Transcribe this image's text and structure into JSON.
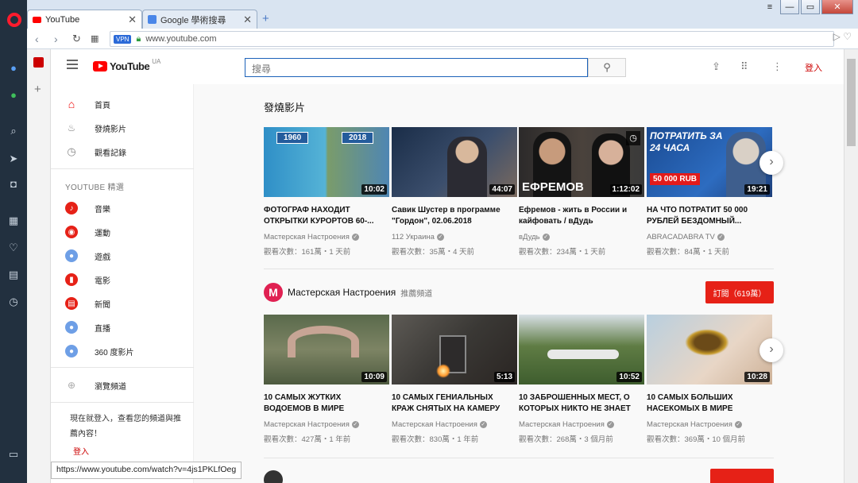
{
  "browser": {
    "tabs": [
      {
        "label": "YouTube",
        "close": "✕"
      },
      {
        "label": "Google 學術搜尋",
        "close": "✕"
      }
    ],
    "new_tab": "+",
    "url": "www.youtube.com",
    "vpn": "VPN",
    "status_url": "https://www.youtube.com/watch?v=4js1PKLfOeg"
  },
  "youtube": {
    "logo": "YouTube",
    "region": "UA",
    "search_placeholder": "搜尋",
    "signin": "登入"
  },
  "guide": {
    "primary": [
      {
        "label": "首頁",
        "icon": "home-icon"
      },
      {
        "label": "發燒影片",
        "icon": "fire-icon"
      },
      {
        "label": "觀看記錄",
        "icon": "history-icon"
      }
    ],
    "section_title": "YOUTUBE 精選",
    "best": [
      {
        "label": "音樂",
        "icon": "music-icon"
      },
      {
        "label": "運動",
        "icon": "sports-icon"
      },
      {
        "label": "遊戲",
        "icon": "gaming-icon"
      },
      {
        "label": "電影",
        "icon": "movies-icon"
      },
      {
        "label": "新聞",
        "icon": "news-icon"
      },
      {
        "label": "直播",
        "icon": "live-icon"
      },
      {
        "label": "360 度影片",
        "icon": "360-icon"
      }
    ],
    "browse": "瀏覽頻道",
    "signin_prompt": "現在就登入，查看您的頻道與推薦內容！",
    "signin_link": "登入"
  },
  "trending": {
    "title": "發燒影片",
    "videos": [
      {
        "title": "ФОТОГРАФ НАХОДИТ ОТКРЫТКИ КУРОРТОВ 60-...",
        "channel": "Мастерская Настроения",
        "views": "觀看次數：161萬・1 天前",
        "duration": "10:02",
        "labels": [
          "1960",
          "2018"
        ]
      },
      {
        "title": "Савик Шустер в программе \"Гордон\", 02.06.2018",
        "channel": "112 Украина",
        "views": "觀看次數：35萬・4 天前",
        "duration": "44:07"
      },
      {
        "title": "Ефремов - жить в России и кайфовать / вДудь",
        "channel": "вДудь",
        "views": "觀看次數：234萬・1 天前",
        "duration": "1:12:02",
        "overlay": "ЕФРЕМОВ"
      },
      {
        "title": "НА ЧТО ПОТРАТИТ 50 000 РУБЛЕЙ БЕЗДОМНЫЙ...",
        "channel": "ABRACADABRA TV",
        "views": "觀看次數：84萬・1 天前",
        "duration": "19:21",
        "overlay1": "ПОТРАТИТЬ ЗА 24 ЧАСА",
        "overlay2": "50 000 RUB"
      }
    ]
  },
  "channel_shelf": {
    "name": "Мастерская Настроения",
    "tag": "推薦頻道",
    "subscribe": "訂閱（619萬）",
    "videos": [
      {
        "title": "10 САМЫХ ЖУТКИХ ВОДОЕМОВ В МИРЕ",
        "channel": "Мастерская Настроения",
        "views": "觀看次數：427萬・1 年前",
        "duration": "10:09"
      },
      {
        "title": "10 САМЫХ ГЕНИАЛЬНЫХ КРАЖ СНЯТЫХ НА КАМЕРУ",
        "channel": "Мастерская Настроения",
        "views": "觀看次數：830萬・1 年前",
        "duration": "5:13"
      },
      {
        "title": "10 ЗАБРОШЕННЫХ МЕСТ, О КОТОРЫХ НИКТО НЕ ЗНАЕТ",
        "channel": "Мастерская Настроения",
        "views": "觀看次數：268萬・3 個月前",
        "duration": "10:52"
      },
      {
        "title": "10 САМЫХ БОЛЬШИХ НАСЕКОМЫХ В МИРЕ",
        "channel": "Мастерская Настроения",
        "views": "觀看次數：369萬・10 個月前",
        "duration": "10:28"
      }
    ]
  },
  "colors": {
    "accent": "#ff0000",
    "subscribe": "#e62117",
    "opera": "#ff1b2d"
  }
}
